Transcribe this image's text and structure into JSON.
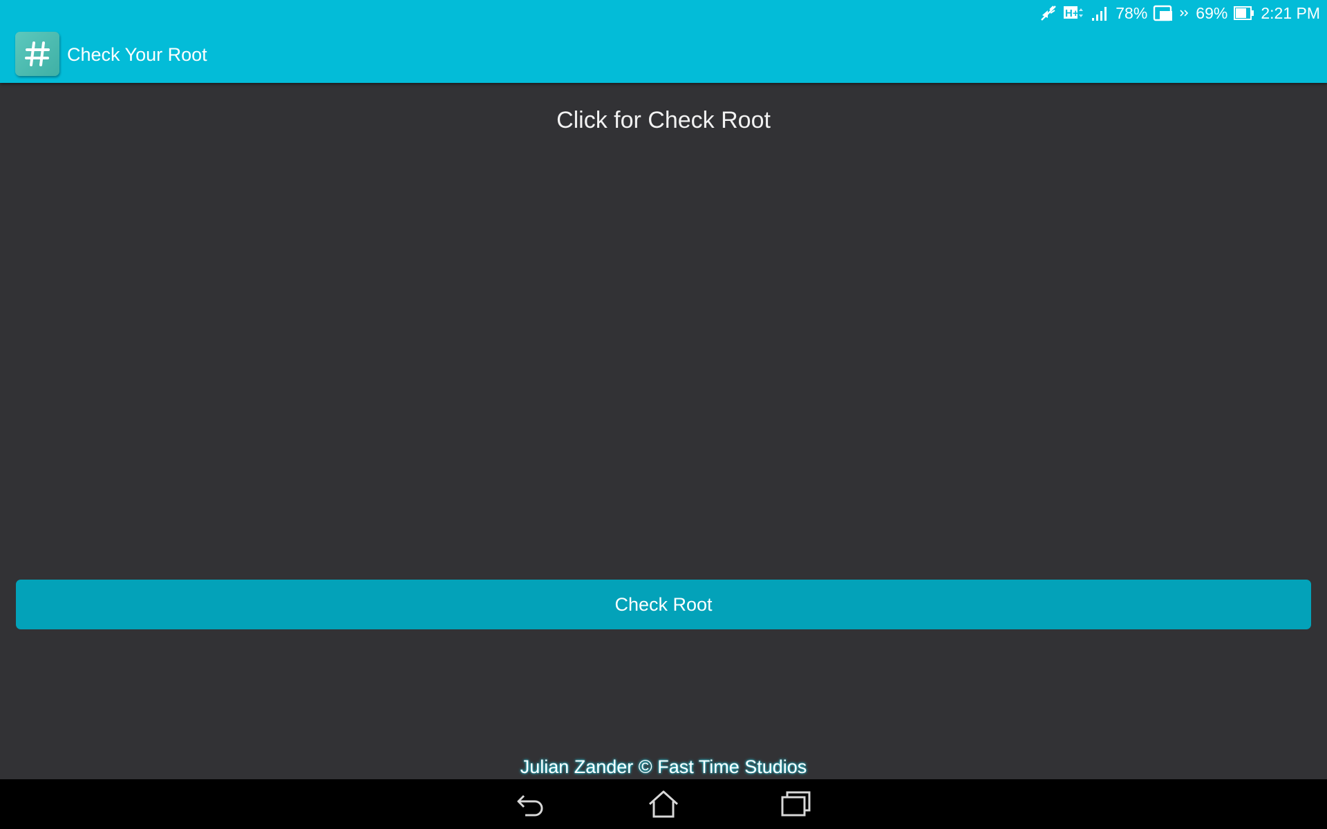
{
  "status_bar": {
    "icons": [
      "mute-icon",
      "hplus-network-icon",
      "signal-icon",
      "screen-cast-icon",
      "more-arrows-icon",
      "battery-icon"
    ],
    "signal_percent": "78%",
    "battery_percent": "69%",
    "time": "2:21 PM"
  },
  "action_bar": {
    "app_icon_glyph": "#",
    "app_icon": "hashtag-app-icon",
    "title": "Check Your Root"
  },
  "main": {
    "instruction": "Click for Check Root",
    "check_button_label": "Check Root",
    "footer_credit": "Julian Zander © Fast Time Studios"
  },
  "nav_bar": {
    "icons": [
      "back-icon",
      "home-icon",
      "recent-apps-icon"
    ]
  },
  "colors": {
    "accent": "#03bcd8",
    "button": "#03a2b9",
    "background": "#323235",
    "navbar": "#000000"
  }
}
